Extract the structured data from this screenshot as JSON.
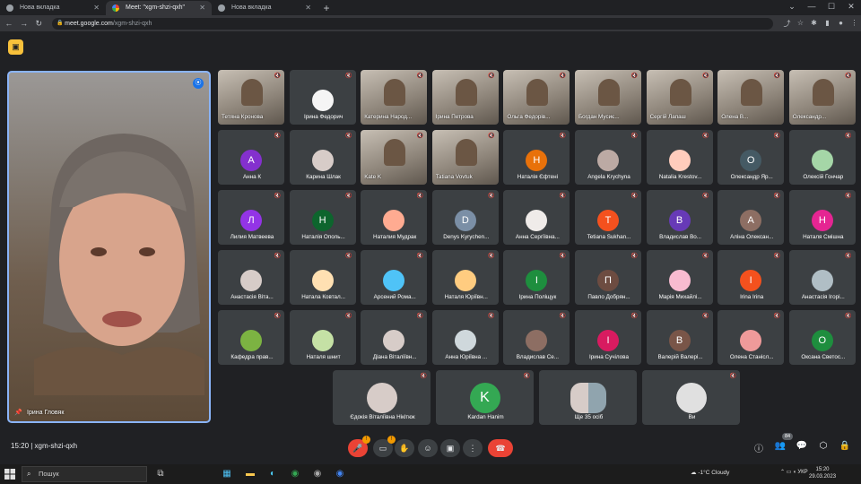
{
  "browser": {
    "tabs": [
      {
        "label": "Нова вкладка",
        "active": false
      },
      {
        "label": "Meet: \"xgm-shzi-qxh\"",
        "active": true
      },
      {
        "label": "Нова вкладка",
        "active": false
      }
    ],
    "url_host": "meet.google.com",
    "url_path": "/xgm-shzi-qxh"
  },
  "meet": {
    "meeting_code": "15:20  |  xgm-shzi-qxh",
    "speaker_name": "Ірина Гловяк",
    "participants_count": "84",
    "tiles": [
      {
        "name": "Тетяна Кронова",
        "type": "video"
      },
      {
        "name": "Ірина Федорич",
        "type": "photo",
        "color": "#f5f5f5"
      },
      {
        "name": "Катерина Народ...",
        "type": "video"
      },
      {
        "name": "Ірина Петрова",
        "type": "video"
      },
      {
        "name": "Ольга Федорів...",
        "type": "video"
      },
      {
        "name": "Богдан Мусиє...",
        "type": "video"
      },
      {
        "name": "Сергій Лапаш",
        "type": "video"
      },
      {
        "name": "Олена В...",
        "type": "video"
      },
      {
        "name": "Олександр...",
        "type": "video"
      },
      {
        "name": "Анна К",
        "type": "letter",
        "letter": "А",
        "color": "#8430ce"
      },
      {
        "name": "Карина Шлак",
        "type": "photo",
        "color": "#d7ccc8"
      },
      {
        "name": "Kate K",
        "type": "video"
      },
      {
        "name": "Tatiana Vovtuk",
        "type": "video"
      },
      {
        "name": "Наталія Єфтені",
        "type": "letter",
        "letter": "Н",
        "color": "#e8710a"
      },
      {
        "name": "Angela Krychyna",
        "type": "photo",
        "color": "#bcaaa4"
      },
      {
        "name": "Natalia Krestov...",
        "type": "photo",
        "color": "#ffccbc"
      },
      {
        "name": "Олександр Яр...",
        "type": "letter",
        "letter": "О",
        "color": "#455a64"
      },
      {
        "name": "Олексій Гончар",
        "type": "photo",
        "color": "#a5d6a7"
      },
      {
        "name": "Лилия Матвеева",
        "type": "letter",
        "letter": "Л",
        "color": "#9334e6"
      },
      {
        "name": "Наталія Ополь...",
        "type": "letter",
        "letter": "Н",
        "color": "#0d652d"
      },
      {
        "name": "Наталия Мудрак",
        "type": "photo",
        "color": "#ffab91"
      },
      {
        "name": "Denys Kyrychen...",
        "type": "letter",
        "letter": "D",
        "color": "#7b8fa6"
      },
      {
        "name": "Анна Сергіївна...",
        "type": "photo",
        "color": "#efebe9"
      },
      {
        "name": "Tetiana Sukhan...",
        "type": "letter",
        "letter": "T",
        "color": "#f4511e"
      },
      {
        "name": "Владислав Во...",
        "type": "letter",
        "letter": "В",
        "color": "#673ab7"
      },
      {
        "name": "Аліна Олексан...",
        "type": "letter",
        "letter": "А",
        "color": "#8d6e63"
      },
      {
        "name": "Наталя Смішна",
        "type": "letter",
        "letter": "Н",
        "color": "#e52592"
      },
      {
        "name": "Анастасія Віта...",
        "type": "photo",
        "color": "#d7ccc8"
      },
      {
        "name": "Натала Ковтал...",
        "type": "photo",
        "color": "#ffe0b2"
      },
      {
        "name": "Арсений Рома...",
        "type": "photo",
        "color": "#4fc3f7"
      },
      {
        "name": "Наталя Юріївн...",
        "type": "photo",
        "color": "#ffcc80"
      },
      {
        "name": "Ірина Поліщук",
        "type": "letter",
        "letter": "І",
        "color": "#1e8e3e"
      },
      {
        "name": "Павло Добрян...",
        "type": "letter",
        "letter": "П",
        "color": "#6d4c41"
      },
      {
        "name": "Марія Михайлі...",
        "type": "photo",
        "color": "#f8bbd0"
      },
      {
        "name": "Irina Irina",
        "type": "letter",
        "letter": "I",
        "color": "#f4511e"
      },
      {
        "name": "Анастасія Ігорі...",
        "type": "photo",
        "color": "#b0bec5"
      },
      {
        "name": "Кафедра прав...",
        "type": "photo",
        "color": "#7cb342"
      },
      {
        "name": "Наталя шнит",
        "type": "photo",
        "color": "#c5e1a5"
      },
      {
        "name": "Діана Віталіївн...",
        "type": "photo",
        "color": "#d7ccc8"
      },
      {
        "name": "Анна Юріївна ...",
        "type": "photo",
        "color": "#cfd8dc"
      },
      {
        "name": "Владислав Се...",
        "type": "photo",
        "color": "#8d6e63"
      },
      {
        "name": "Ірина Сучілова",
        "type": "letter",
        "letter": "І",
        "color": "#d81b60"
      },
      {
        "name": "Валерій Валері...",
        "type": "letter",
        "letter": "В",
        "color": "#795548"
      },
      {
        "name": "Олена Станісл...",
        "type": "photo",
        "color": "#ef9a9a"
      },
      {
        "name": "Оксана Светос...",
        "type": "letter",
        "letter": "О",
        "color": "#1e8e3e"
      }
    ],
    "last_row": [
      {
        "name": "Єдокія Віталіївна Нікітюк",
        "type": "photo",
        "color": "#d7ccc8"
      },
      {
        "name": "Kardan Hanim",
        "type": "letter",
        "letter": "K",
        "color": "#34a853"
      },
      {
        "name": "Ще 35 осіб",
        "type": "group"
      },
      {
        "name": "Ви",
        "type": "photo",
        "color": "#e0e0e0"
      }
    ]
  },
  "taskbar": {
    "search_placeholder": "Пошук",
    "weather": "-1°C  Cloudy",
    "lang": "УКР",
    "time": "15:20",
    "date": "29.03.2023"
  }
}
